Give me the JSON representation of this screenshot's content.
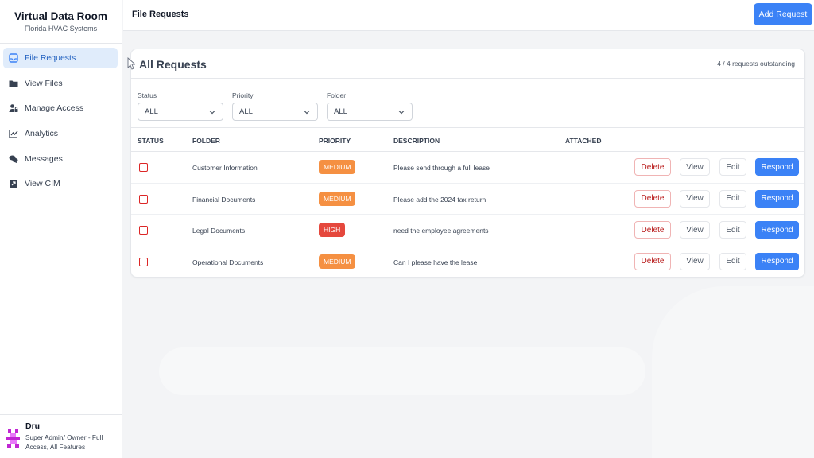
{
  "brand": {
    "title": "Virtual Data Room",
    "subtitle": "Florida HVAC Systems"
  },
  "sidebar": {
    "items": [
      {
        "label": "File Requests",
        "icon": "inbox-icon",
        "active": true
      },
      {
        "label": "View Files",
        "icon": "folder-icon",
        "active": false
      },
      {
        "label": "Manage Access",
        "icon": "user-lock-icon",
        "active": false
      },
      {
        "label": "Analytics",
        "icon": "chart-line-icon",
        "active": false
      },
      {
        "label": "Messages",
        "icon": "comments-icon",
        "active": false
      },
      {
        "label": "View CIM",
        "icon": "external-link-icon",
        "active": false
      }
    ]
  },
  "user": {
    "name": "Dru",
    "role": "Super Admin/ Owner - Full Access, All Features"
  },
  "header": {
    "title": "File Requests",
    "add_button": "Add Request"
  },
  "card": {
    "title": "All Requests",
    "count": "4 / 4 requests outstanding",
    "filters": [
      {
        "label": "Status",
        "value": "ALL"
      },
      {
        "label": "Priority",
        "value": "ALL"
      },
      {
        "label": "Folder",
        "value": "ALL"
      }
    ],
    "columns": [
      "STATUS",
      "FOLDER",
      "PRIORITY",
      "DESCRIPTION",
      "ATTACHED"
    ],
    "actions": {
      "delete": "Delete",
      "view": "View",
      "edit": "Edit",
      "respond": "Respond"
    },
    "rows": [
      {
        "folder": "Customer Information",
        "priority": "MEDIUM",
        "description": "Please send through a full lease",
        "attached": ""
      },
      {
        "folder": "Financial Documents",
        "priority": "MEDIUM",
        "description": "Please add the 2024 tax return",
        "attached": ""
      },
      {
        "folder": "Legal Documents",
        "priority": "HIGH",
        "description": "need the employee agreements",
        "attached": ""
      },
      {
        "folder": "Operational Documents",
        "priority": "MEDIUM",
        "description": "Can I please have the lease",
        "attached": ""
      }
    ]
  },
  "colors": {
    "accent": "#3b82f6",
    "medium": "#f59042",
    "high": "#e5483d",
    "delete": "#b91c1c"
  }
}
